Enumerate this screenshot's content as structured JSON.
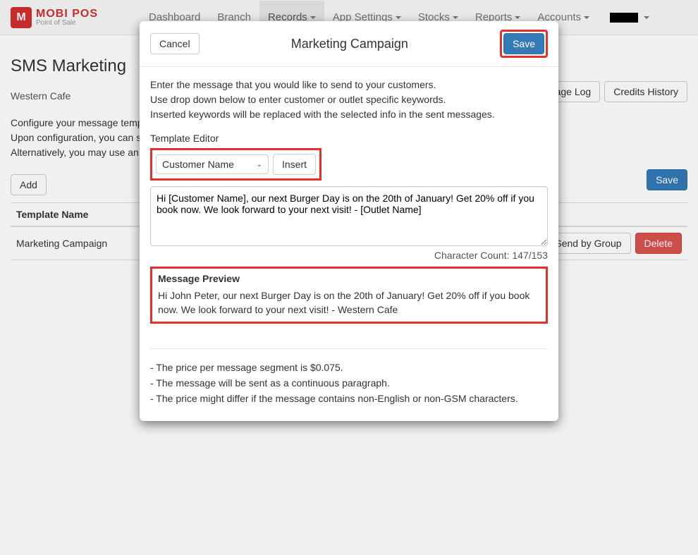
{
  "brand": {
    "logo_letter": "M",
    "main": "MOBI POS",
    "sub": "Point of Sale"
  },
  "nav": {
    "items": [
      "Dashboard",
      "Branch",
      "Records",
      "App Settings",
      "Stocks",
      "Reports",
      "Accounts"
    ],
    "active_index": 2
  },
  "page": {
    "title": "SMS Marketing",
    "breadcrumb": "Western Cafe",
    "description_lines": [
      "Configure your message template, save it, and click on the respective buttons to broadcast it to the specified customers.",
      "Upon configuration, you can schedule the template to be sent automatically at a specified time.",
      "Alternatively, you may use an existing template."
    ],
    "actions": {
      "message_log": "Message Log",
      "credits_history": "Credits History"
    },
    "add_button": "Add",
    "save_button": "Save",
    "table_header": "Template Name",
    "row": {
      "name": "Marketing Campaign",
      "send_group": "Send by Group",
      "delete": "Delete"
    }
  },
  "modal": {
    "cancel": "Cancel",
    "title": "Marketing Campaign",
    "save": "Save",
    "instructions": [
      "Enter the message that you would like to send to your customers.",
      "Use drop down below to enter customer or outlet specific keywords.",
      "Inserted keywords will be replaced with the selected info in the sent messages."
    ],
    "template_editor_label": "Template Editor",
    "dropdown_value": "Customer Name",
    "insert_button": "Insert",
    "textarea_value": "Hi [Customer Name], our next Burger Day is on the 20th of January! Get 20% off if you book now. We look forward to your next visit! - [Outlet Name]",
    "char_count": "Character Count: 147/153",
    "preview_label": "Message Preview",
    "preview_text": "Hi John Peter, our next Burger Day is on the 20th of January! Get 20% off if you book now. We look forward to your next visit! - Western Cafe",
    "notes": [
      "- The price per message segment is $0.075.",
      "- The message will be sent as a continuous paragraph.",
      "- The price might differ if the message contains non-English or non-GSM characters."
    ]
  }
}
